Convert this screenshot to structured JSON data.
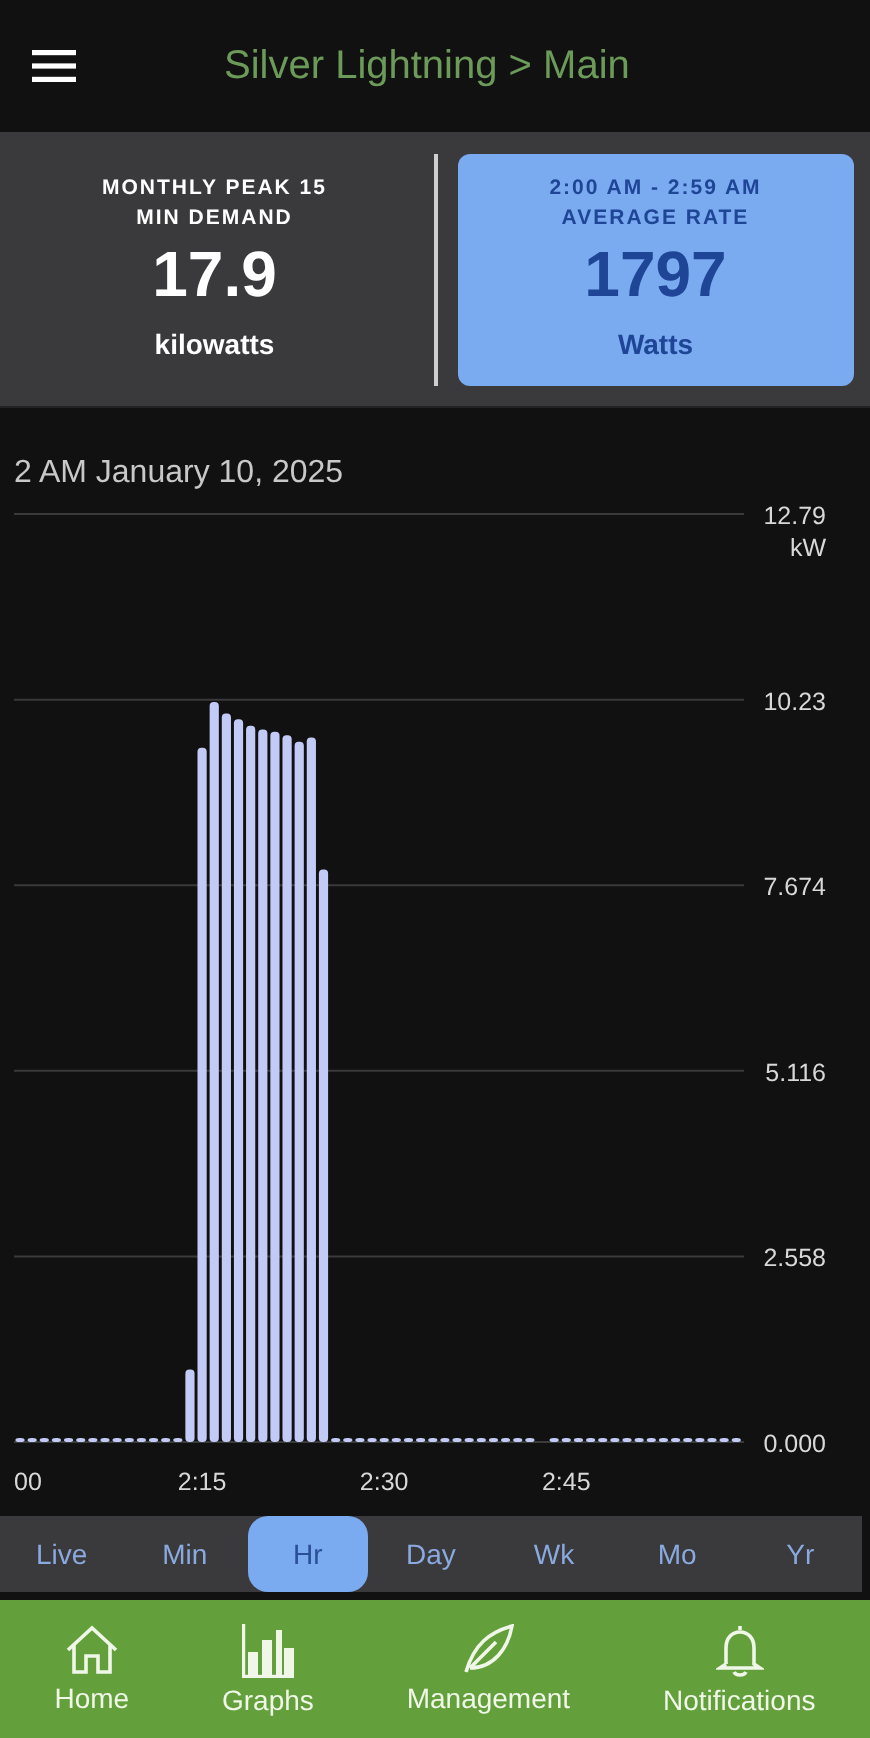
{
  "header": {
    "title": "Silver Lightning > Main"
  },
  "summary": [
    {
      "label_lines": [
        "MONTHLY PEAK 15",
        "MIN DEMAND"
      ],
      "value": "17.9",
      "unit": "kilowatts",
      "selected": false
    },
    {
      "label_lines": [
        "2:00 AM - 2:59 AM",
        "AVERAGE RATE"
      ],
      "value": "1797",
      "unit": "Watts",
      "selected": true
    }
  ],
  "chart": {
    "date": "2 AM January 10, 2025",
    "chart_data": {
      "type": "bar",
      "ylabel": "kW",
      "categories": [
        "00",
        null,
        null,
        null,
        null,
        null,
        null,
        null,
        null,
        null,
        null,
        null,
        null,
        null,
        null,
        "2:15",
        null,
        null,
        null,
        null,
        null,
        null,
        null,
        null,
        null,
        null,
        null,
        null,
        null,
        null,
        "2:30",
        null,
        null,
        null,
        null,
        null,
        null,
        null,
        null,
        null,
        null,
        null,
        null,
        null,
        null,
        "2:45",
        null,
        null,
        null,
        null,
        null,
        null,
        null,
        null,
        null,
        null,
        null,
        null,
        null,
        null
      ],
      "values": [
        0,
        0,
        0,
        0,
        0,
        0,
        0,
        0,
        0,
        0,
        0,
        0,
        0,
        0,
        1.0,
        9.57,
        10.2,
        10.04,
        9.96,
        9.87,
        9.82,
        9.79,
        9.74,
        9.65,
        9.71,
        7.89,
        0,
        0,
        0,
        0,
        0,
        0,
        0,
        0,
        0,
        0,
        0,
        0,
        0,
        0,
        0,
        0,
        0,
        null,
        0,
        0,
        0,
        0,
        0,
        0,
        0,
        0,
        0,
        0,
        0,
        0,
        0,
        0,
        0,
        0
      ],
      "ylim": [
        0,
        12.79
      ],
      "grid": true,
      "yticks": [
        {
          "value": 0,
          "label": "0.000"
        },
        {
          "value": 2.558,
          "label": "2.558"
        },
        {
          "value": 5.116,
          "label": "5.116"
        },
        {
          "value": 7.674,
          "label": "7.674"
        },
        {
          "value": 10.23,
          "label": "10.23"
        },
        {
          "value": 12.79,
          "label": "12.79"
        }
      ]
    }
  },
  "ranges": [
    {
      "label": "Live",
      "selected": false
    },
    {
      "label": "Min",
      "selected": false
    },
    {
      "label": "Hr",
      "selected": true
    },
    {
      "label": "Day",
      "selected": false
    },
    {
      "label": "Wk",
      "selected": false
    },
    {
      "label": "Mo",
      "selected": false
    },
    {
      "label": "Yr",
      "selected": false
    }
  ],
  "nav": [
    {
      "kind": "home",
      "label": "Home"
    },
    {
      "kind": "graphs",
      "label": "Graphs"
    },
    {
      "kind": "leaf",
      "label": "Management"
    },
    {
      "kind": "bell",
      "label": "Notifications"
    }
  ]
}
